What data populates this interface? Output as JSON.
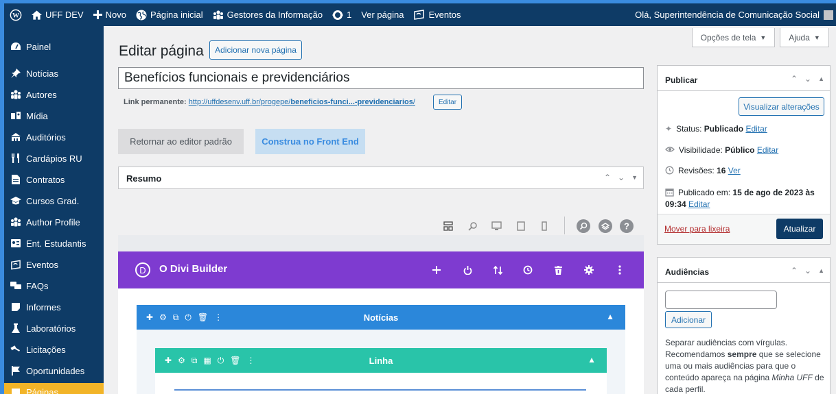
{
  "adminbar": {
    "site_name": "UFF DEV",
    "new_label": "Novo",
    "home_label": "Página inicial",
    "gestores_label": "Gestores da Informação",
    "updates_count": "1",
    "view_label": "Ver página",
    "events_label": "Eventos",
    "greeting": "Olá, Superintendência de Comunicação Social"
  },
  "sidebar": {
    "items": [
      {
        "label": "Painel",
        "icon": "dashboard-icon"
      },
      {
        "label": "Notícias",
        "icon": "pin-icon"
      },
      {
        "label": "Autores",
        "icon": "groups-icon"
      },
      {
        "label": "Mídia",
        "icon": "media-icon"
      },
      {
        "label": "Auditórios",
        "icon": "building-icon"
      },
      {
        "label": "Cardápios RU",
        "icon": "food-icon"
      },
      {
        "label": "Contratos",
        "icon": "document-icon"
      },
      {
        "label": "Cursos Grad.",
        "icon": "graduation-icon"
      },
      {
        "label": "Author Profile",
        "icon": "groups-icon"
      },
      {
        "label": "Ent. Estudantis",
        "icon": "id-icon"
      },
      {
        "label": "Eventos",
        "icon": "events-icon"
      },
      {
        "label": "FAQs",
        "icon": "faq-icon"
      },
      {
        "label": "Informes",
        "icon": "note-icon"
      },
      {
        "label": "Laboratórios",
        "icon": "flask-icon"
      },
      {
        "label": "Licitações",
        "icon": "auction-icon"
      },
      {
        "label": "Oportunidades",
        "icon": "flag-icon"
      },
      {
        "label": "Páginas",
        "icon": "pages-icon"
      }
    ]
  },
  "editor": {
    "heading": "Editar página",
    "add_new": "Adicionar nova página",
    "title_value": "Benefícios funcionais e previdenciários",
    "permalink_label": "Link permanente:",
    "permalink_base": "http://uffdesenv.uff.br/progepe/",
    "permalink_slug": "beneficios-funci...-previdenciarios",
    "permalink_end": "/",
    "permalink_edit": "Editar",
    "return_editor": "Retornar ao editor padrão",
    "front_end": "Construa no Front End",
    "resumo": "Resumo"
  },
  "divi": {
    "logo": "D",
    "title": "O Divi Builder",
    "section_label": "Notícias",
    "row_label": "Linha"
  },
  "screen_options": {
    "options_label": "Opções de tela",
    "help_label": "Ajuda"
  },
  "publish": {
    "title": "Publicar",
    "preview": "Visualizar alterações",
    "status_label": "Status:",
    "status_value": "Publicado",
    "visibility_label": "Visibilidade:",
    "visibility_value": "Público",
    "revisions_label": "Revisões:",
    "revisions_value": "16",
    "revisions_link": "Ver",
    "published_label": "Publicado em:",
    "published_value": "15 de ago de 2023 às",
    "published_time": "09:34",
    "edit": "Editar",
    "trash": "Mover para lixeira",
    "update": "Atualizar"
  },
  "audiences": {
    "title": "Audiências",
    "add": "Adicionar",
    "help_1": "Separar audiências com vírgulas.",
    "help_2a": "Recomendamos ",
    "help_2b": "sempre",
    "help_2c": " que se selecione",
    "help_3": "uma ou mais audiências para que o",
    "help_4a": "conteúdo apareça na página ",
    "help_4b": "Minha UFF",
    "help_4c": " de",
    "help_5": "cada perfil."
  },
  "colors": {
    "admin_bg": "#0e3b66",
    "active_menu": "#f2b428",
    "divi_purple": "#7e3bd0",
    "section_blue": "#2b87da",
    "row_teal": "#29c4a9",
    "primary_button": "#0e3b66"
  }
}
